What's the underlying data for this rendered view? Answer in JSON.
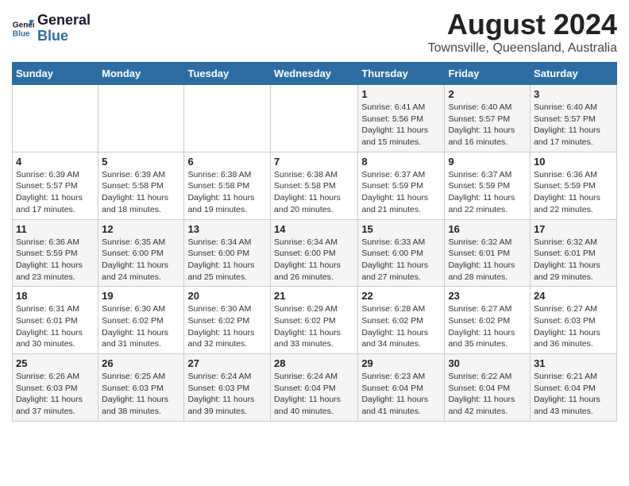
{
  "header": {
    "logo_line1": "General",
    "logo_line2": "Blue",
    "main_title": "August 2024",
    "subtitle": "Townsville, Queensland, Australia"
  },
  "columns": [
    "Sunday",
    "Monday",
    "Tuesday",
    "Wednesday",
    "Thursday",
    "Friday",
    "Saturday"
  ],
  "weeks": [
    [
      {
        "day": "",
        "info": ""
      },
      {
        "day": "",
        "info": ""
      },
      {
        "day": "",
        "info": ""
      },
      {
        "day": "",
        "info": ""
      },
      {
        "day": "1",
        "info": "Sunrise: 6:41 AM\nSunset: 5:56 PM\nDaylight: 11 hours and 15 minutes."
      },
      {
        "day": "2",
        "info": "Sunrise: 6:40 AM\nSunset: 5:57 PM\nDaylight: 11 hours and 16 minutes."
      },
      {
        "day": "3",
        "info": "Sunrise: 6:40 AM\nSunset: 5:57 PM\nDaylight: 11 hours and 17 minutes."
      }
    ],
    [
      {
        "day": "4",
        "info": "Sunrise: 6:39 AM\nSunset: 5:57 PM\nDaylight: 11 hours and 17 minutes."
      },
      {
        "day": "5",
        "info": "Sunrise: 6:39 AM\nSunset: 5:58 PM\nDaylight: 11 hours and 18 minutes."
      },
      {
        "day": "6",
        "info": "Sunrise: 6:38 AM\nSunset: 5:58 PM\nDaylight: 11 hours and 19 minutes."
      },
      {
        "day": "7",
        "info": "Sunrise: 6:38 AM\nSunset: 5:58 PM\nDaylight: 11 hours and 20 minutes."
      },
      {
        "day": "8",
        "info": "Sunrise: 6:37 AM\nSunset: 5:59 PM\nDaylight: 11 hours and 21 minutes."
      },
      {
        "day": "9",
        "info": "Sunrise: 6:37 AM\nSunset: 5:59 PM\nDaylight: 11 hours and 22 minutes."
      },
      {
        "day": "10",
        "info": "Sunrise: 6:36 AM\nSunset: 5:59 PM\nDaylight: 11 hours and 22 minutes."
      }
    ],
    [
      {
        "day": "11",
        "info": "Sunrise: 6:36 AM\nSunset: 5:59 PM\nDaylight: 11 hours and 23 minutes."
      },
      {
        "day": "12",
        "info": "Sunrise: 6:35 AM\nSunset: 6:00 PM\nDaylight: 11 hours and 24 minutes."
      },
      {
        "day": "13",
        "info": "Sunrise: 6:34 AM\nSunset: 6:00 PM\nDaylight: 11 hours and 25 minutes."
      },
      {
        "day": "14",
        "info": "Sunrise: 6:34 AM\nSunset: 6:00 PM\nDaylight: 11 hours and 26 minutes."
      },
      {
        "day": "15",
        "info": "Sunrise: 6:33 AM\nSunset: 6:00 PM\nDaylight: 11 hours and 27 minutes."
      },
      {
        "day": "16",
        "info": "Sunrise: 6:32 AM\nSunset: 6:01 PM\nDaylight: 11 hours and 28 minutes."
      },
      {
        "day": "17",
        "info": "Sunrise: 6:32 AM\nSunset: 6:01 PM\nDaylight: 11 hours and 29 minutes."
      }
    ],
    [
      {
        "day": "18",
        "info": "Sunrise: 6:31 AM\nSunset: 6:01 PM\nDaylight: 11 hours and 30 minutes."
      },
      {
        "day": "19",
        "info": "Sunrise: 6:30 AM\nSunset: 6:02 PM\nDaylight: 11 hours and 31 minutes."
      },
      {
        "day": "20",
        "info": "Sunrise: 6:30 AM\nSunset: 6:02 PM\nDaylight: 11 hours and 32 minutes."
      },
      {
        "day": "21",
        "info": "Sunrise: 6:29 AM\nSunset: 6:02 PM\nDaylight: 11 hours and 33 minutes."
      },
      {
        "day": "22",
        "info": "Sunrise: 6:28 AM\nSunset: 6:02 PM\nDaylight: 11 hours and 34 minutes."
      },
      {
        "day": "23",
        "info": "Sunrise: 6:27 AM\nSunset: 6:02 PM\nDaylight: 11 hours and 35 minutes."
      },
      {
        "day": "24",
        "info": "Sunrise: 6:27 AM\nSunset: 6:03 PM\nDaylight: 11 hours and 36 minutes."
      }
    ],
    [
      {
        "day": "25",
        "info": "Sunrise: 6:26 AM\nSunset: 6:03 PM\nDaylight: 11 hours and 37 minutes."
      },
      {
        "day": "26",
        "info": "Sunrise: 6:25 AM\nSunset: 6:03 PM\nDaylight: 11 hours and 38 minutes."
      },
      {
        "day": "27",
        "info": "Sunrise: 6:24 AM\nSunset: 6:03 PM\nDaylight: 11 hours and 39 minutes."
      },
      {
        "day": "28",
        "info": "Sunrise: 6:24 AM\nSunset: 6:04 PM\nDaylight: 11 hours and 40 minutes."
      },
      {
        "day": "29",
        "info": "Sunrise: 6:23 AM\nSunset: 6:04 PM\nDaylight: 11 hours and 41 minutes."
      },
      {
        "day": "30",
        "info": "Sunrise: 6:22 AM\nSunset: 6:04 PM\nDaylight: 11 hours and 42 minutes."
      },
      {
        "day": "31",
        "info": "Sunrise: 6:21 AM\nSunset: 6:04 PM\nDaylight: 11 hours and 43 minutes."
      }
    ]
  ]
}
